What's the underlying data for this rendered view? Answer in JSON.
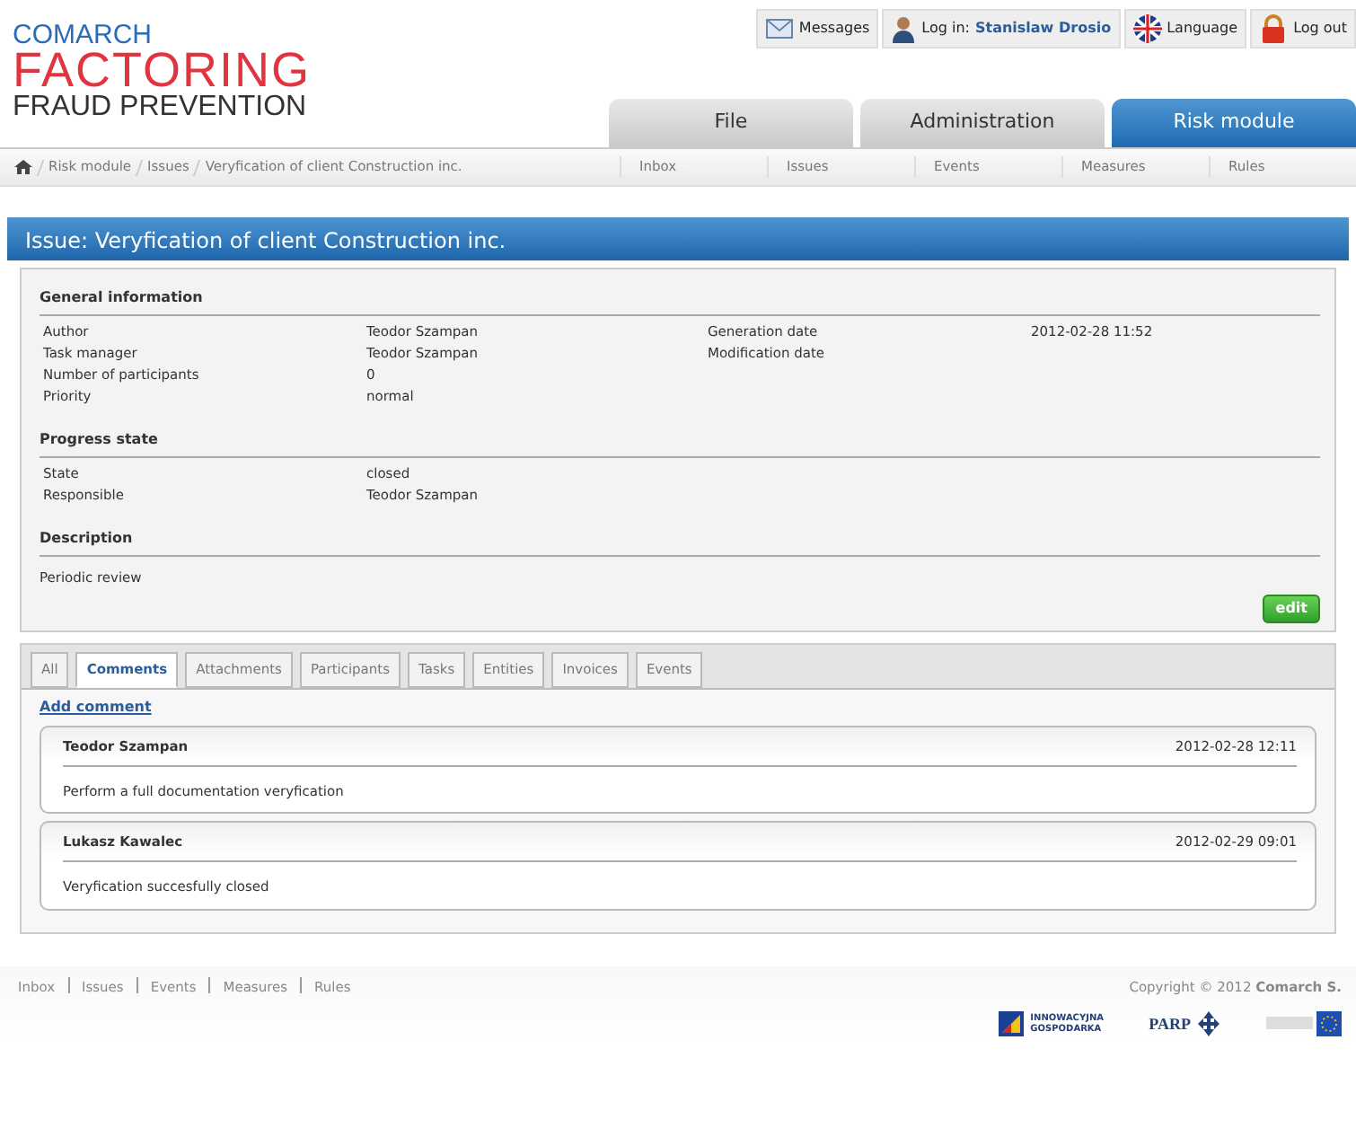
{
  "logo": {
    "brand": "COMARCH",
    "product": "FACTORING",
    "subtitle": "FRAUD PREVENTION"
  },
  "top_links": [
    {
      "kind": "messages",
      "label": "Messages"
    },
    {
      "kind": "user",
      "label": "Log in:",
      "user": "Stanislaw Drosio"
    },
    {
      "kind": "language",
      "label": "Language"
    },
    {
      "kind": "logout",
      "label": "Log out"
    }
  ],
  "main_tabs": [
    {
      "label": "File",
      "selected": false
    },
    {
      "label": "Administration",
      "selected": false
    },
    {
      "label": "Risk module",
      "selected": true
    }
  ],
  "breadcrumb": [
    "Risk module",
    "Issues",
    "Veryfication of client Construction inc."
  ],
  "sub_nav": [
    "Inbox",
    "Issues",
    "Events",
    "Measures",
    "Rules"
  ],
  "page_title": "Issue: Veryfication of client Construction inc.",
  "sections": [
    {
      "title": "General information",
      "rows": [
        [
          "Author",
          "Teodor Szampan",
          "Generation date",
          "2012-02-28 11:52"
        ],
        [
          "Task manager",
          "Teodor Szampan",
          "Modification date",
          ""
        ],
        [
          "Number of participants",
          "0",
          "",
          ""
        ],
        [
          "Priority",
          "normal",
          "",
          ""
        ]
      ]
    },
    {
      "title": "Progress state",
      "rows": [
        [
          "State",
          "closed",
          "",
          ""
        ],
        [
          "Responsible",
          "Teodor Szampan",
          "",
          ""
        ]
      ]
    },
    {
      "title": "Description",
      "text": "Periodic review"
    }
  ],
  "edit_button": "edit",
  "detail_tabs": [
    {
      "label": "All",
      "selected": false
    },
    {
      "label": "Comments",
      "selected": true
    },
    {
      "label": "Attachments",
      "selected": false
    },
    {
      "label": "Participants",
      "selected": false
    },
    {
      "label": "Tasks",
      "selected": false
    },
    {
      "label": "Entities",
      "selected": false
    },
    {
      "label": "Invoices",
      "selected": false
    },
    {
      "label": "Events",
      "selected": false
    }
  ],
  "add_comment": "Add comment",
  "comments": [
    {
      "author": "Teodor Szampan",
      "date": "2012-02-28 12:11",
      "text": "Perform a full documentation veryfication"
    },
    {
      "author": "Lukasz Kawalec",
      "date": "2012-02-29 09:01",
      "text": "Veryfication succesfully closed"
    }
  ],
  "footer": {
    "links": [
      "Inbox",
      "Issues",
      "Events",
      "Measures",
      "Rules"
    ],
    "copyright": "Copyright © 2012 **Comarch S.**",
    "sponsors": [
      "INNOWACYJNA GOSPODARKA",
      "PARP"
    ]
  }
}
